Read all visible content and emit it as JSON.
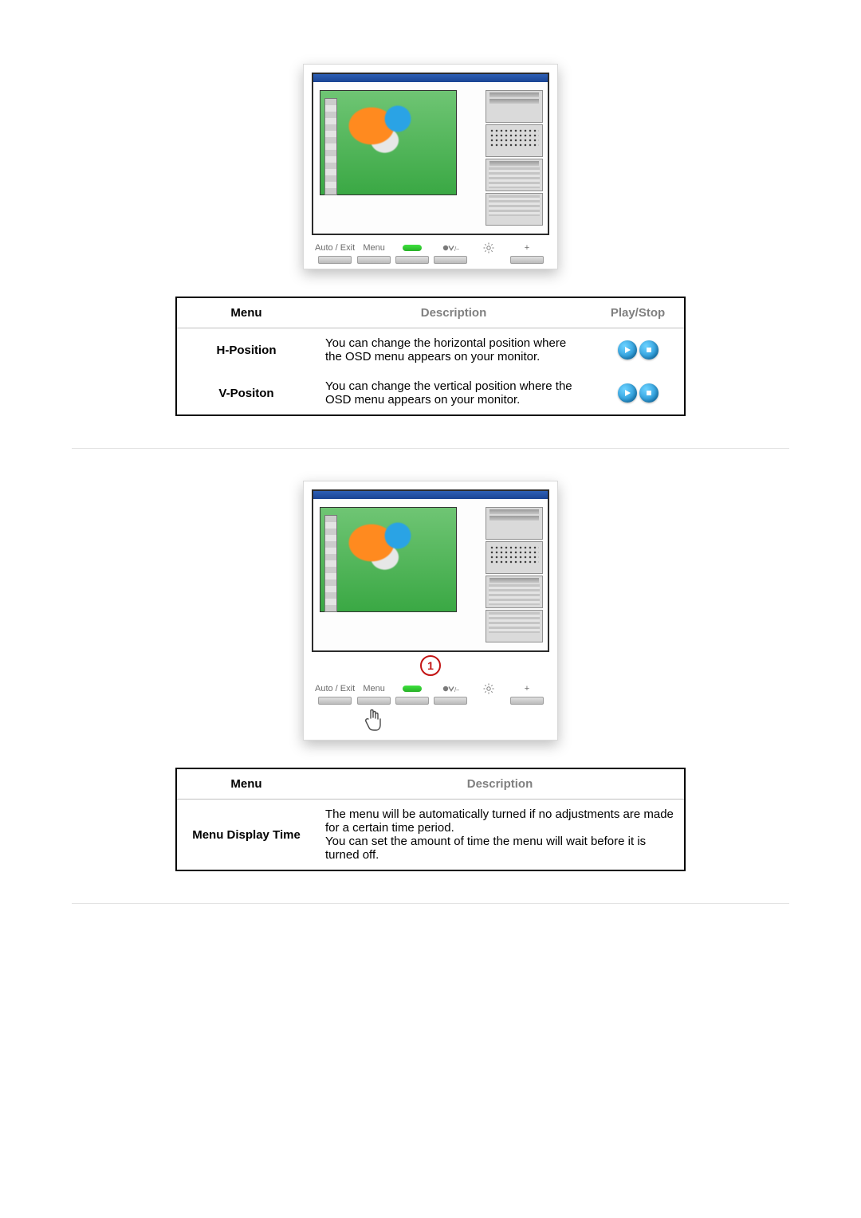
{
  "icons": {
    "auto_exit": "Auto / Exit",
    "menu": "Menu",
    "minus_bright": "/ —",
    "plus": "+"
  },
  "monitor2": {
    "callout": "1"
  },
  "table1": {
    "headers": {
      "menu": "Menu",
      "description": "Description",
      "playstop": "Play/Stop"
    },
    "rows": [
      {
        "menu": "H-Position",
        "desc": "You can change the horizontal position where the OSD menu appears on your monitor."
      },
      {
        "menu": "V-Positon",
        "desc": "You can change the vertical position where the OSD menu appears on your monitor."
      }
    ]
  },
  "table2": {
    "headers": {
      "menu": "Menu",
      "description": "Description"
    },
    "rows": [
      {
        "menu": "Menu Display Time",
        "desc": "The menu will be automatically turned if no adjustments are made for a certain time period.\nYou can set the amount of time the menu will wait before it is turned off."
      }
    ]
  }
}
